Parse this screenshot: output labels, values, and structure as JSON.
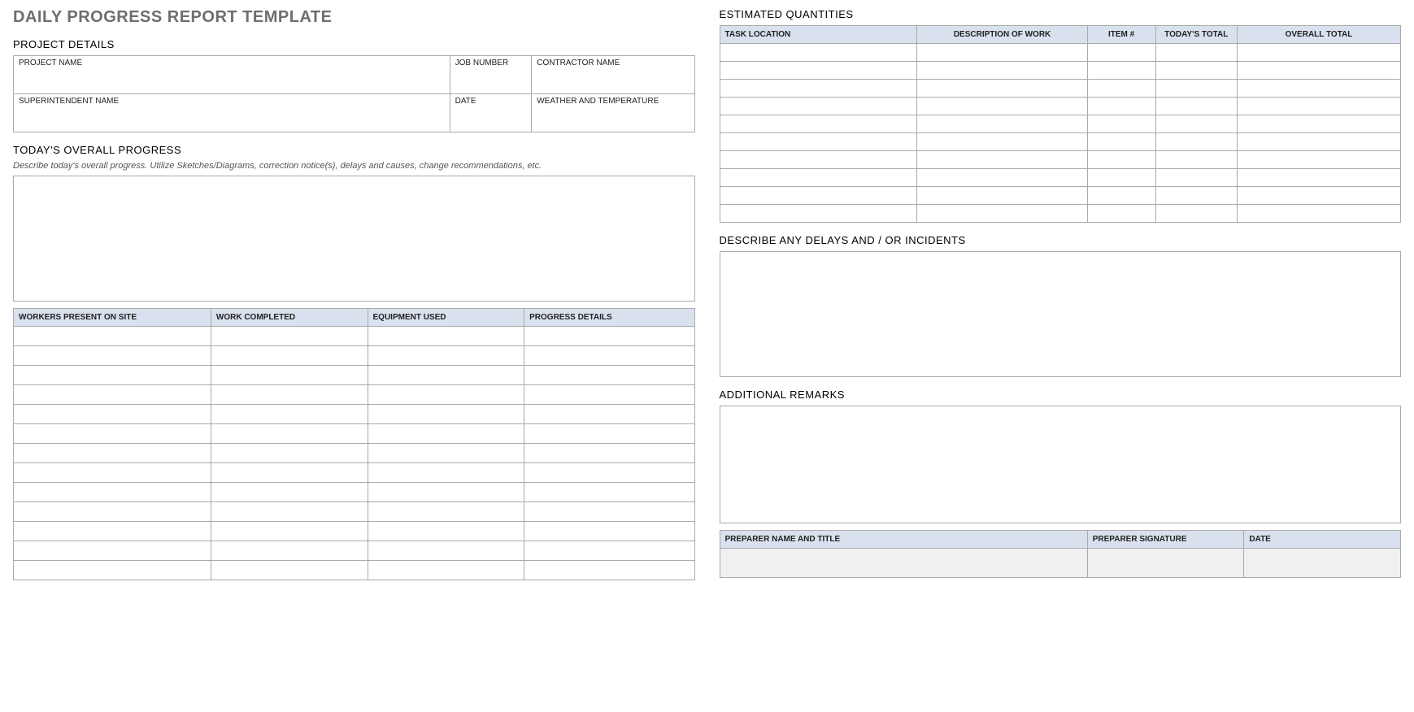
{
  "title": "DAILY PROGRESS REPORT TEMPLATE",
  "project_details": {
    "heading": "PROJECT DETAILS",
    "row1": {
      "project_name_label": "PROJECT NAME",
      "job_number_label": "JOB NUMBER",
      "contractor_name_label": "CONTRACTOR NAME",
      "project_name_value": "",
      "job_number_value": "",
      "contractor_name_value": ""
    },
    "row2": {
      "superintendent_label": "SUPERINTENDENT NAME",
      "date_label": "DATE",
      "weather_label": "WEATHER AND TEMPERATURE",
      "superintendent_value": "",
      "date_value": "",
      "weather_value": ""
    }
  },
  "overall_progress": {
    "heading": "TODAY'S OVERALL PROGRESS",
    "helper": "Describe today's overall progress.  Utilize Sketches/Diagrams, correction notice(s), delays and causes, change recommendations, etc.",
    "value": ""
  },
  "work_table": {
    "headers": [
      "WORKERS PRESENT ON SITE",
      "WORK COMPLETED",
      "EQUIPMENT USED",
      "PROGRESS DETAILS"
    ],
    "rows": [
      [
        "",
        "",
        "",
        ""
      ],
      [
        "",
        "",
        "",
        ""
      ],
      [
        "",
        "",
        "",
        ""
      ],
      [
        "",
        "",
        "",
        ""
      ],
      [
        "",
        "",
        "",
        ""
      ],
      [
        "",
        "",
        "",
        ""
      ],
      [
        "",
        "",
        "",
        ""
      ],
      [
        "",
        "",
        "",
        ""
      ],
      [
        "",
        "",
        "",
        ""
      ],
      [
        "",
        "",
        "",
        ""
      ],
      [
        "",
        "",
        "",
        ""
      ],
      [
        "",
        "",
        "",
        ""
      ],
      [
        "",
        "",
        "",
        ""
      ]
    ]
  },
  "estimated_quantities": {
    "heading": "ESTIMATED QUANTITIES",
    "headers": [
      "TASK LOCATION",
      "DESCRIPTION OF WORK",
      "ITEM #",
      "TODAY'S TOTAL",
      "OVERALL TOTAL"
    ],
    "rows": [
      [
        "",
        "",
        "",
        "",
        ""
      ],
      [
        "",
        "",
        "",
        "",
        ""
      ],
      [
        "",
        "",
        "",
        "",
        ""
      ],
      [
        "",
        "",
        "",
        "",
        ""
      ],
      [
        "",
        "",
        "",
        "",
        ""
      ],
      [
        "",
        "",
        "",
        "",
        ""
      ],
      [
        "",
        "",
        "",
        "",
        ""
      ],
      [
        "",
        "",
        "",
        "",
        ""
      ],
      [
        "",
        "",
        "",
        "",
        ""
      ],
      [
        "",
        "",
        "",
        "",
        ""
      ]
    ]
  },
  "delays": {
    "heading": "DESCRIBE ANY DELAYS AND / OR INCIDENTS",
    "value": ""
  },
  "remarks": {
    "heading": "ADDITIONAL REMARKS",
    "value": ""
  },
  "signoff": {
    "headers": [
      "PREPARER NAME AND TITLE",
      "PREPARER SIGNATURE",
      "DATE"
    ],
    "values": [
      "",
      "",
      ""
    ]
  }
}
